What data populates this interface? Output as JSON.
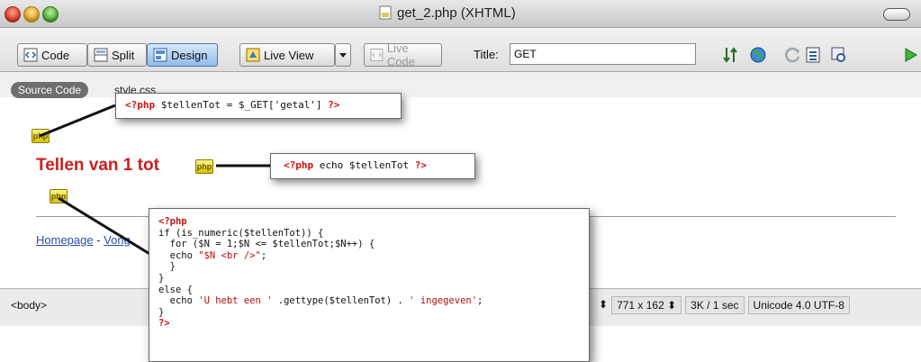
{
  "window": {
    "title": "get_2.php (XHTML)"
  },
  "toolbar": {
    "code_label": "Code",
    "split_label": "Split",
    "design_label": "Design",
    "live_view_label": "Live View",
    "live_code_label": "Live Code",
    "title_label": "Title:",
    "title_value": "GET"
  },
  "related_files": {
    "source_code_label": "Source Code",
    "stylesheet_label": "style.css"
  },
  "design": {
    "php_marker_text": "php",
    "heading": "Tellen van 1 tot",
    "footer_home": "Homepage",
    "footer_separator": " - ",
    "footer_next": "Vorig"
  },
  "status": {
    "tag_selector": "<body>",
    "window_size": "771 x 162",
    "download": "3K / 1 sec",
    "encoding": "Unicode 4.0 UTF-8"
  },
  "callouts": {
    "top": {
      "open": "<?php",
      "code": " $tellenTot = $_GET['getal'] ",
      "close": "?>"
    },
    "middle": {
      "open": "<?php",
      "code": " echo $tellenTot ",
      "close": "?>"
    },
    "bottom": {
      "open": "<?php",
      "line1": "if (is_numeric($tellenTot)) {",
      "line2": "  for ($N = 1;$N <= $tellenTot;$N++) {",
      "line3a": "  echo ",
      "line3b": "\"$N <br />\"",
      "line3c": ";",
      "line4": "  }",
      "line5": "}",
      "line6": "else {",
      "line7a": "  echo ",
      "line7b": "'U hebt een '",
      "line7c": " .gettype($tellenTot) . ",
      "line7d": "' ingegeven'",
      "line7e": ";",
      "line8": "}",
      "close": "?>"
    }
  }
}
